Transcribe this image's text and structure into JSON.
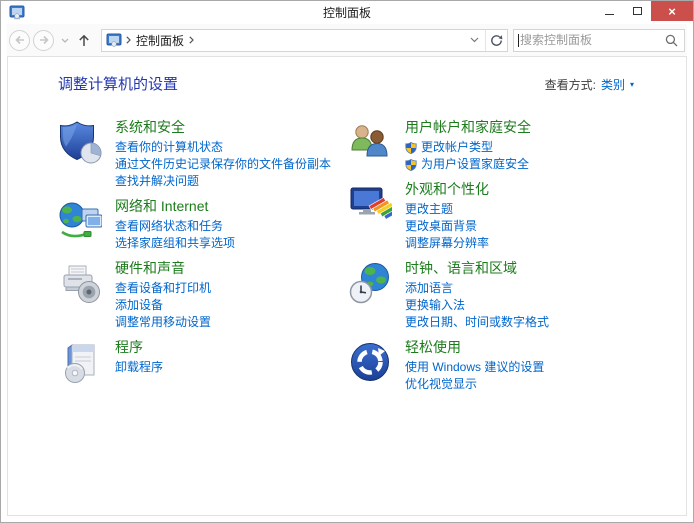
{
  "window": {
    "title": "控制面板"
  },
  "titlebar": {
    "close_glyph": "×"
  },
  "navbar": {
    "breadcrumb_root": "控制面板",
    "search_placeholder": "搜索控制面板"
  },
  "page_header": {
    "title": "调整计算机的设置",
    "view_by_label": "查看方式:",
    "view_by_value": "类别",
    "view_by_arrow": "▾"
  },
  "categories": {
    "left": [
      {
        "title": "系统和安全",
        "icon": "security-shield-icon",
        "links": [
          {
            "text": "查看你的计算机状态"
          },
          {
            "text": "通过文件历史记录保存你的文件备份副本"
          },
          {
            "text": "查找并解决问题"
          }
        ]
      },
      {
        "title": "网络和 Internet",
        "icon": "network-globe-icon",
        "links": [
          {
            "text": "查看网络状态和任务"
          },
          {
            "text": "选择家庭组和共享选项"
          }
        ]
      },
      {
        "title": "硬件和声音",
        "icon": "printer-speaker-icon",
        "links": [
          {
            "text": "查看设备和打印机"
          },
          {
            "text": "添加设备"
          },
          {
            "text": "调整常用移动设置"
          }
        ]
      },
      {
        "title": "程序",
        "icon": "software-box-icon",
        "links": [
          {
            "text": "卸载程序"
          }
        ]
      }
    ],
    "right": [
      {
        "title": "用户帐户和家庭安全",
        "icon": "user-accounts-icon",
        "links": [
          {
            "text": "更改帐户类型",
            "uac_shield": true
          },
          {
            "text": "为用户设置家庭安全",
            "uac_shield": true
          }
        ]
      },
      {
        "title": "外观和个性化",
        "icon": "personalization-icon",
        "links": [
          {
            "text": "更改主题"
          },
          {
            "text": "更改桌面背景"
          },
          {
            "text": "调整屏幕分辨率"
          }
        ]
      },
      {
        "title": "时钟、语言和区域",
        "icon": "clock-region-icon",
        "links": [
          {
            "text": "添加语言"
          },
          {
            "text": "更换输入法"
          },
          {
            "text": "更改日期、时间或数字格式"
          }
        ]
      },
      {
        "title": "轻松使用",
        "icon": "ease-of-access-icon",
        "links": [
          {
            "text": "使用 Windows 建议的设置"
          },
          {
            "text": "优化视觉显示"
          }
        ]
      }
    ]
  },
  "colors": {
    "category_title_green": "#1c7c1c",
    "link_blue": "#0066cc",
    "header_blue": "#2438ad",
    "close_button_red": "#cb4f4b"
  }
}
